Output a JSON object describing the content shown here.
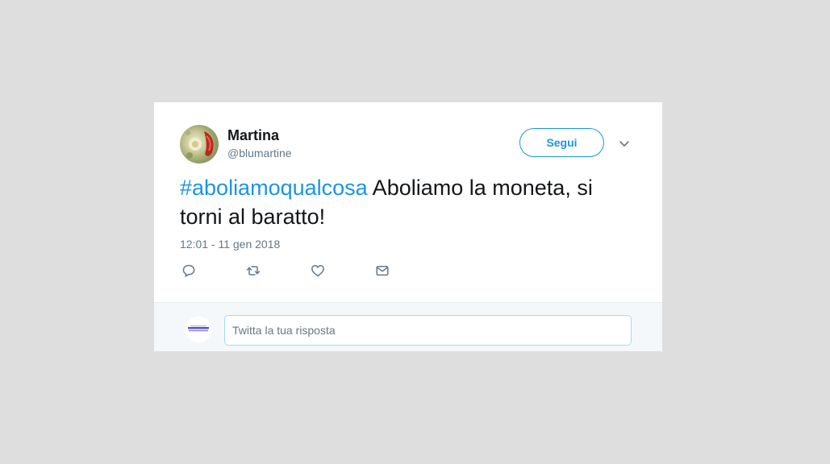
{
  "tweet": {
    "author": {
      "display_name": "Martina",
      "username": "@blumartine",
      "avatar_icon": "profile-photo"
    },
    "follow_label": "Segui",
    "text": {
      "hashtag": "#aboliamoqualcosa",
      "body": " Aboliamo la moneta, si torni al baratto!"
    },
    "timestamp": "12:01 - 11 gen 2018",
    "actions": [
      {
        "name": "reply",
        "icon": "reply-icon"
      },
      {
        "name": "retweet",
        "icon": "retweet-icon"
      },
      {
        "name": "like",
        "icon": "heart-icon"
      },
      {
        "name": "direct-message",
        "icon": "envelope-icon"
      }
    ]
  },
  "reply": {
    "placeholder": "Twitta la tua risposta"
  },
  "colors": {
    "accent": "#1b95e0",
    "text": "#14171a",
    "muted": "#657786",
    "page_bg": "#dedede"
  }
}
